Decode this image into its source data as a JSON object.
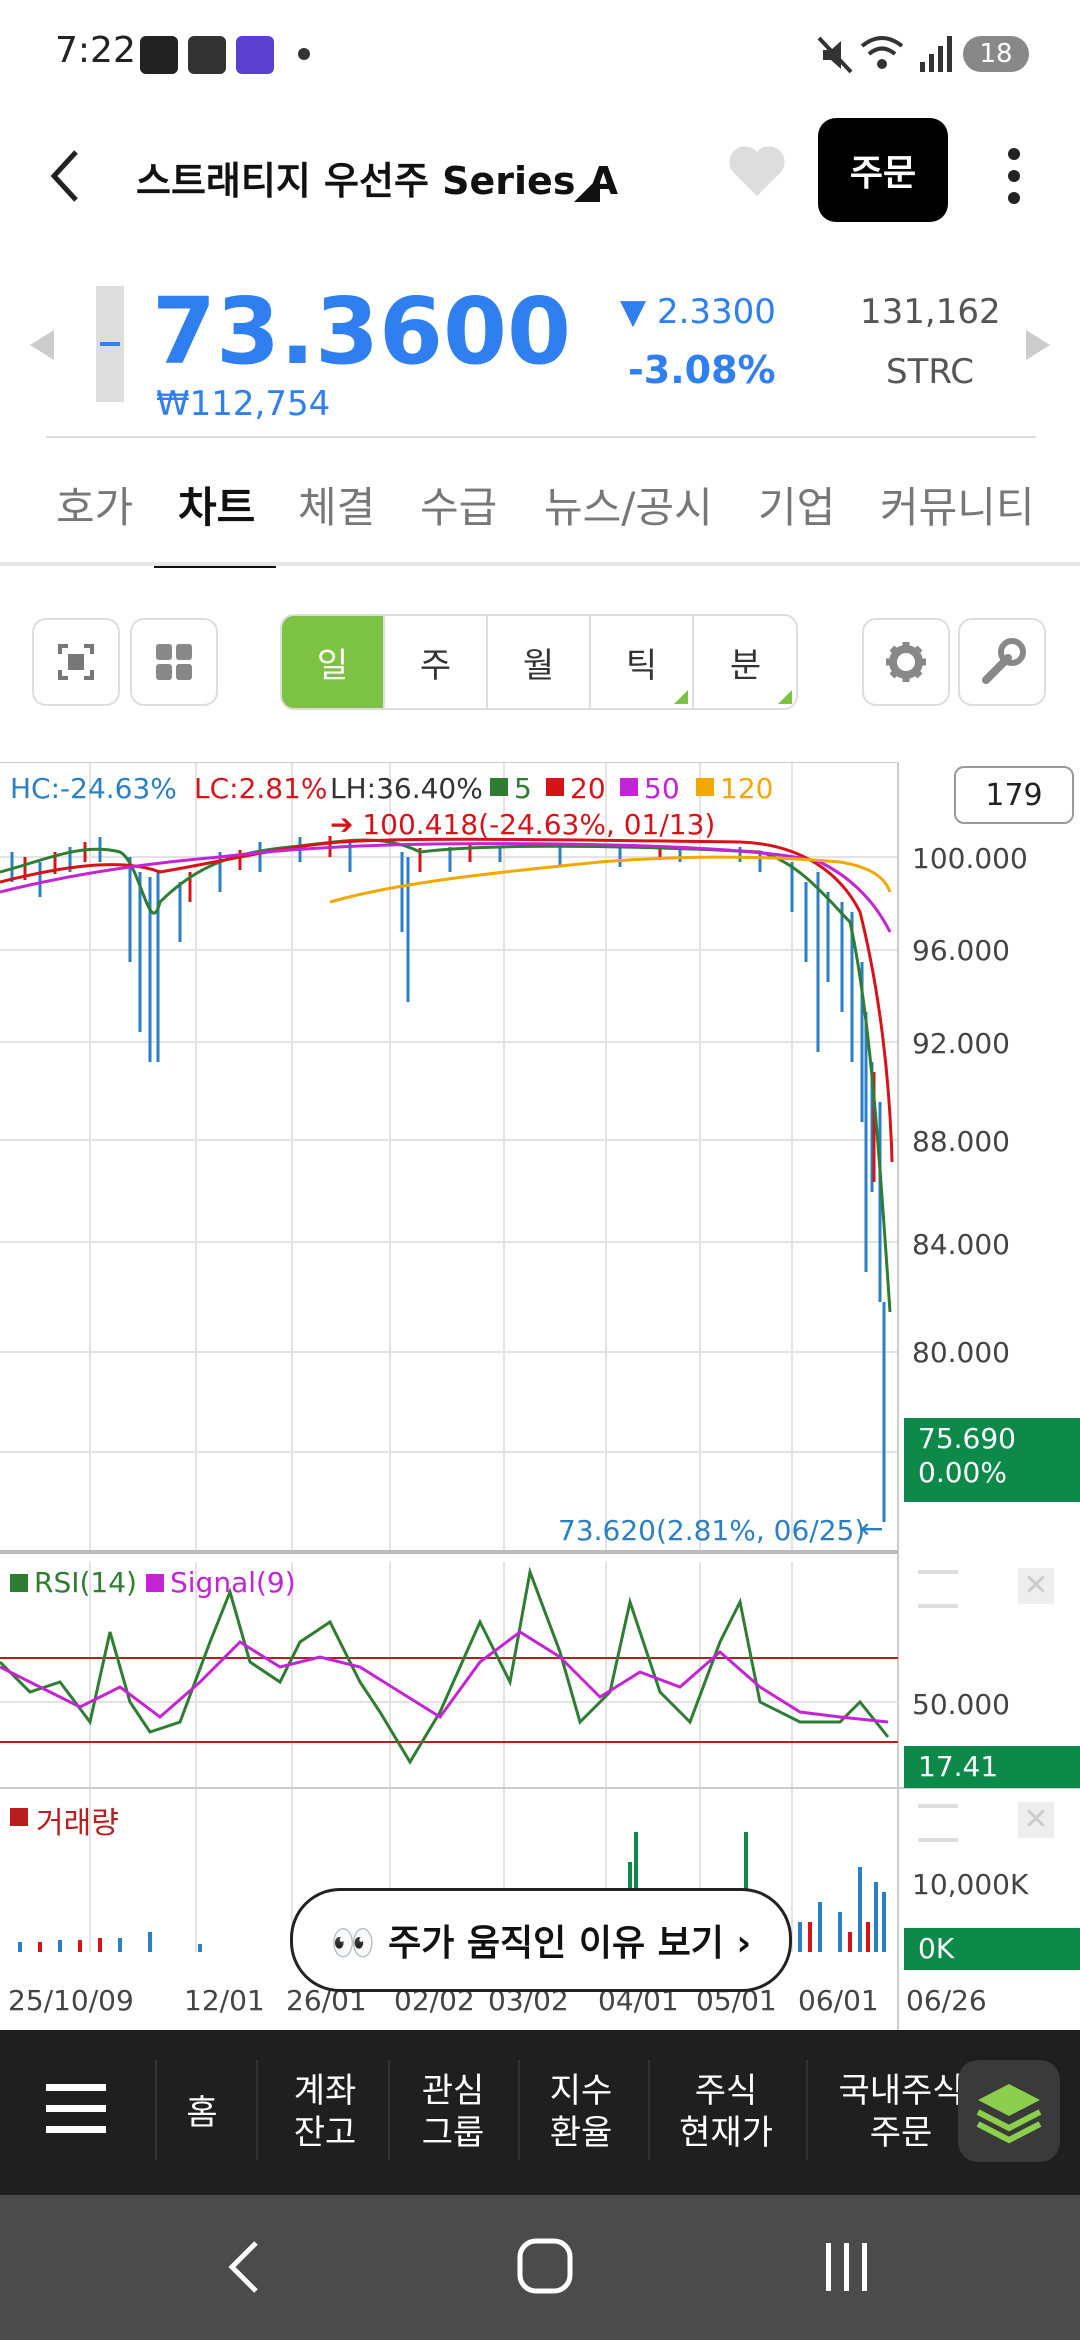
{
  "status_bar": {
    "time": "7:22",
    "icons": [
      "webtoon-app-icon",
      "webtoon-icon",
      "home-app-icon",
      "dot-icon"
    ],
    "right_icons": [
      "mute-icon",
      "wifi-icon",
      "signal-icon"
    ],
    "battery": "18"
  },
  "header": {
    "title": "스트래티지 우선주 Series A",
    "order_label": "주문"
  },
  "quote": {
    "price": "73.3600",
    "krw": "₩112,754",
    "change": "▼ 2.3300",
    "change_pct": "-3.08%",
    "volume": "131,162",
    "ticker": "STRC"
  },
  "tabs": [
    "호가",
    "차트",
    "체결",
    "수급",
    "뉴스/공시",
    "기업",
    "커뮤니티"
  ],
  "active_tab": "차트",
  "periods": [
    "일",
    "주",
    "월",
    "틱",
    "분"
  ],
  "active_period": "일",
  "chart_header": {
    "hc": "HC:-24.63%",
    "lc": "LC:2.81%",
    "lh": "LH:36.40%",
    "ma_labels": [
      "5",
      "20",
      "50",
      "120"
    ],
    "high_note": "➔ 100.418(-24.63%, 01/13)",
    "count_box": "179"
  },
  "price_axis": [
    "100.000",
    "96.000",
    "92.000",
    "88.000",
    "84.000",
    "80.000"
  ],
  "current_tag": {
    "value": "75.690",
    "pct": "0.00%"
  },
  "low_note": "73.620(2.81%, 06/25)",
  "rsi": {
    "label": "RSI(14)",
    "signal": "Signal(9)",
    "axis": "50.000",
    "tag": "17.41"
  },
  "volume_panel": {
    "label": "거래량",
    "axis": "10,000K",
    "tag": "0K"
  },
  "date_axis": [
    "25/10/09",
    "12/01",
    "26/01",
    "02/02",
    "03/02",
    "04/01",
    "05/01",
    "06/01",
    "06/26"
  ],
  "why_button": "👀 주가 움직인 이유 보기  ›",
  "bottom_nav": [
    {
      "l1": "홈",
      "l2": ""
    },
    {
      "l1": "계좌",
      "l2": "잔고"
    },
    {
      "l1": "관심",
      "l2": "그룹"
    },
    {
      "l1": "지수",
      "l2": "환율"
    },
    {
      "l1": "주식",
      "l2": "현재가"
    },
    {
      "l1": "국내주식",
      "l2": "주문"
    }
  ],
  "colors": {
    "blue": "#2f7ff0",
    "green": "#7cc243",
    "down_tag": "#0d8a4a",
    "ma5": "#2e7d32",
    "ma20": "#d7131a",
    "ma50": "#c424d4",
    "ma120": "#f2a800"
  }
}
